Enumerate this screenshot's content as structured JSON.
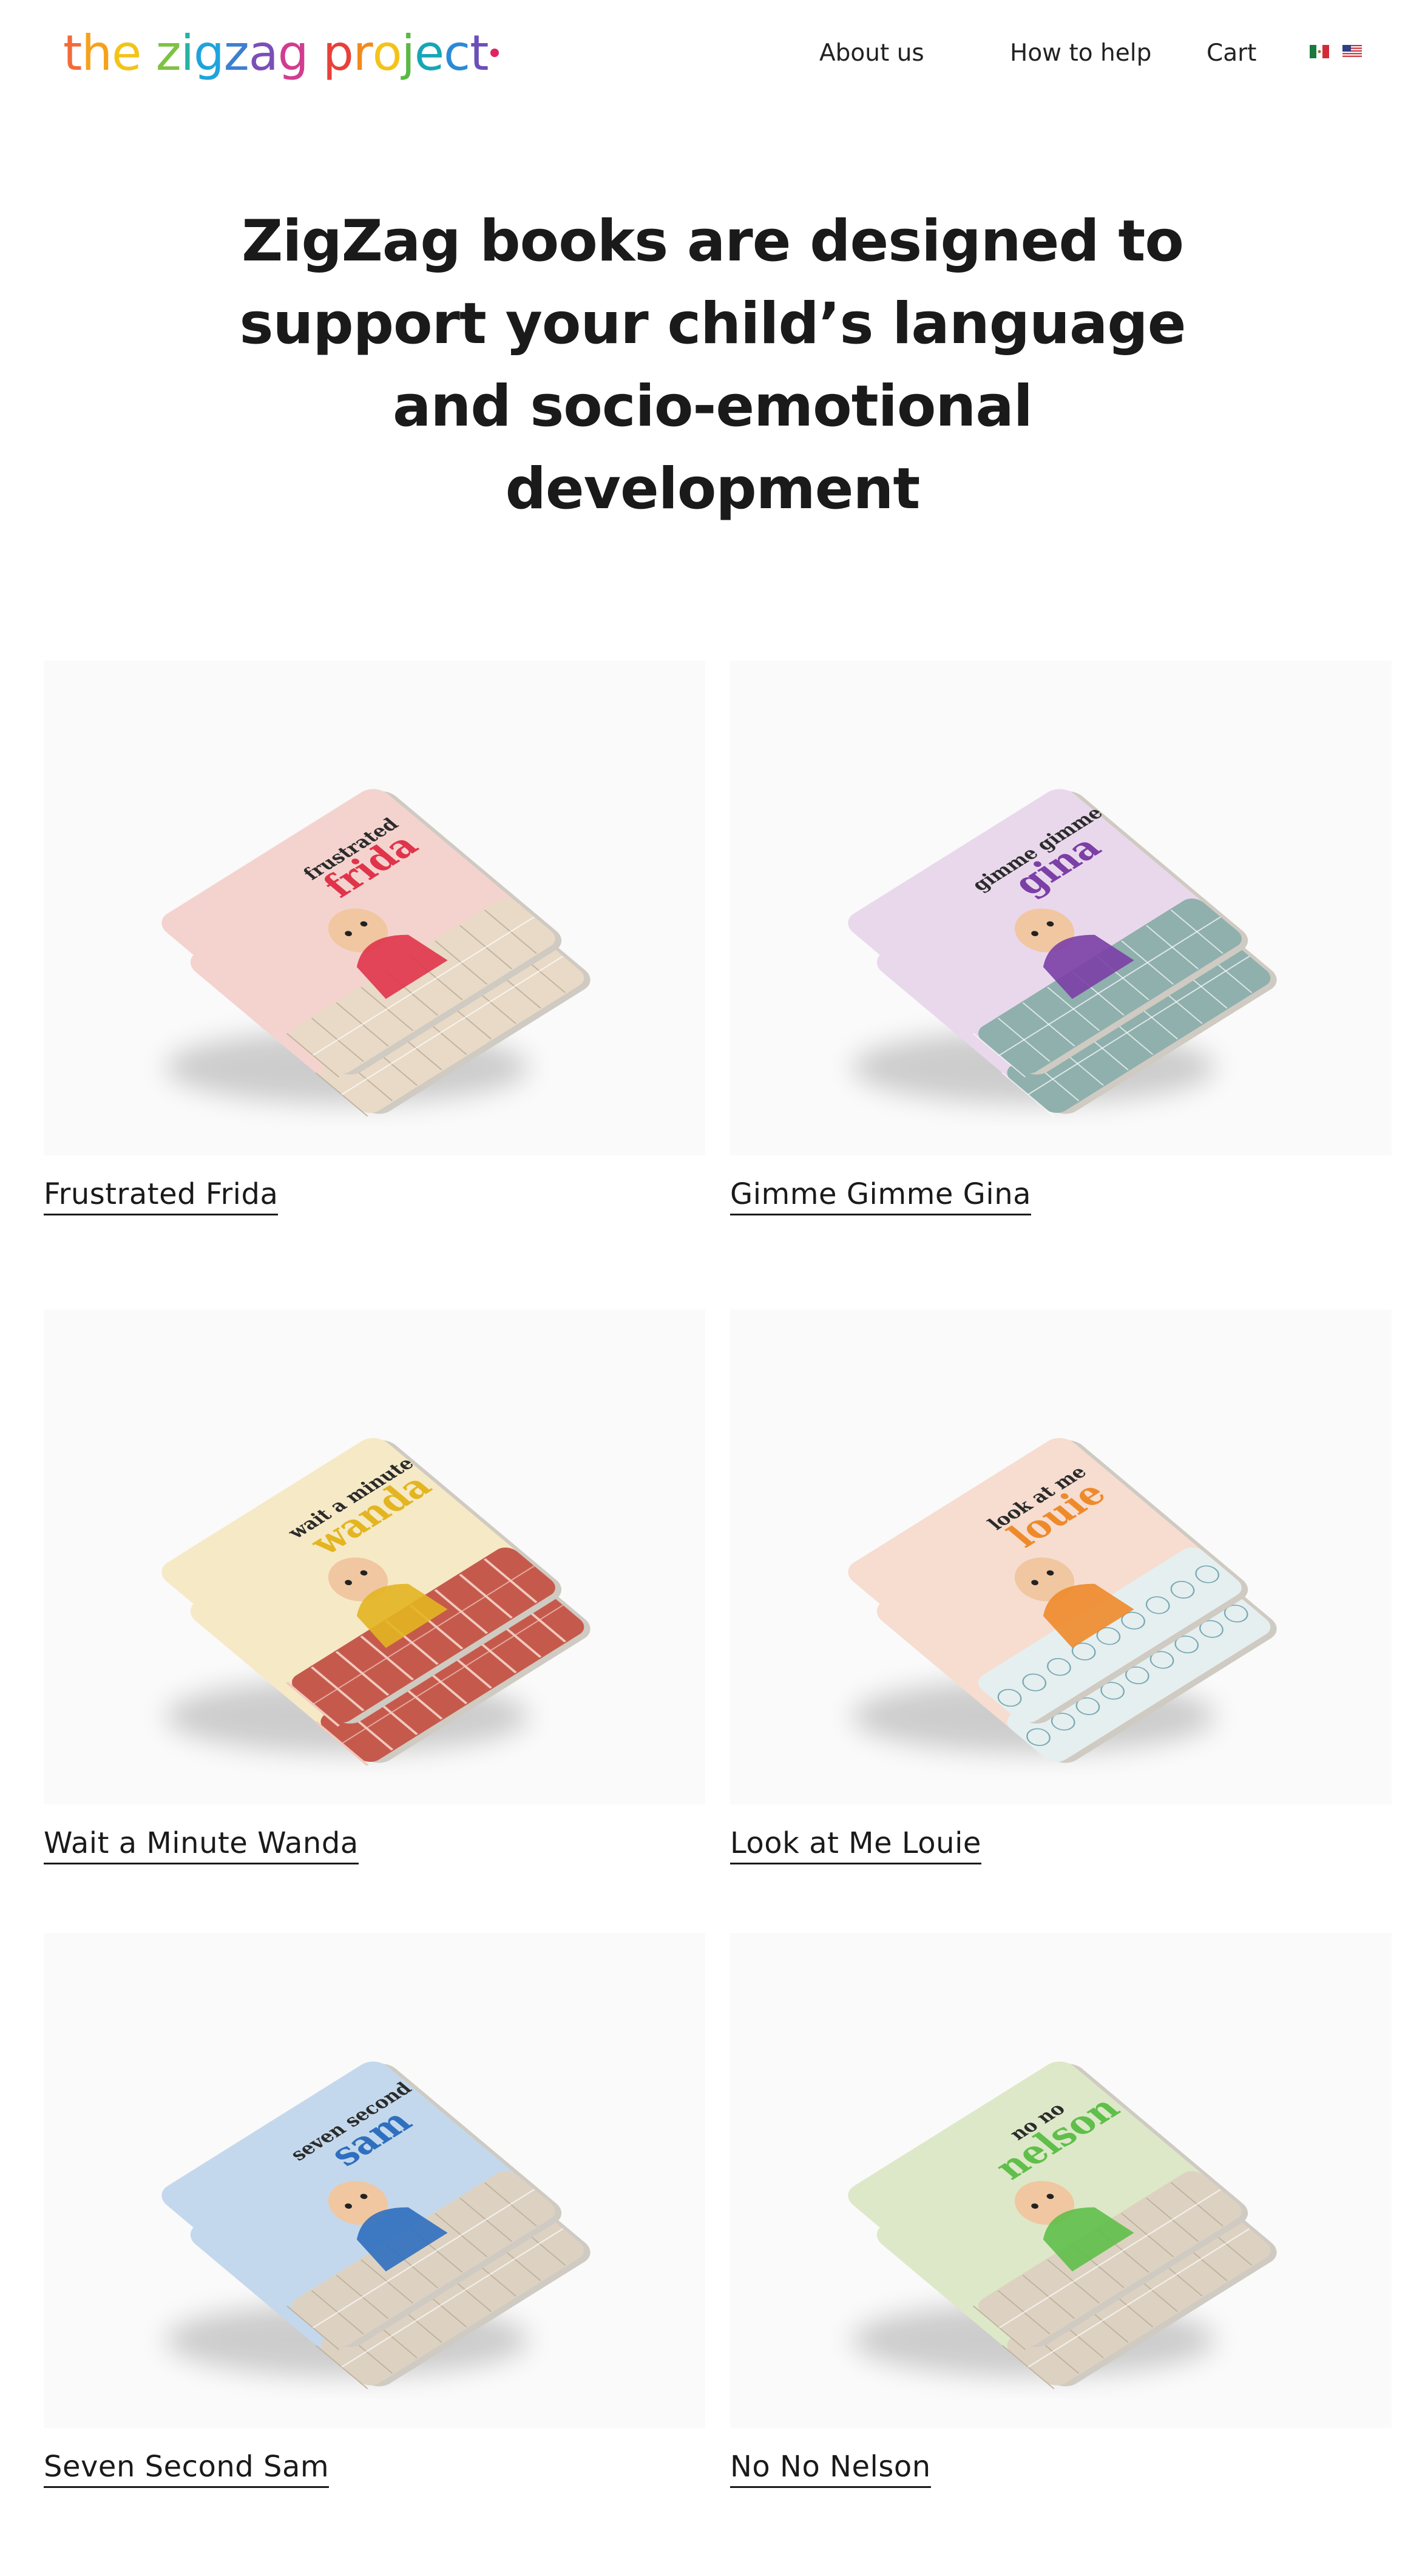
{
  "header": {
    "logo": {
      "text": "the zigzag project",
      "letters": [
        {
          "ch": "t",
          "color": "#f26b3a"
        },
        {
          "ch": "h",
          "color": "#f6a11c"
        },
        {
          "ch": "e",
          "color": "#f3c319"
        },
        {
          "ch": " ",
          "color": "#000000"
        },
        {
          "ch": "z",
          "color": "#7dc242"
        },
        {
          "ch": "i",
          "color": "#25b3a4"
        },
        {
          "ch": "g",
          "color": "#1fa3dd"
        },
        {
          "ch": "z",
          "color": "#3d7fd0"
        },
        {
          "ch": "a",
          "color": "#7a4fb8"
        },
        {
          "ch": "g",
          "color": "#d23c8f"
        },
        {
          "ch": " ",
          "color": "#000000"
        },
        {
          "ch": "p",
          "color": "#e8403a"
        },
        {
          "ch": "r",
          "color": "#f28a1c"
        },
        {
          "ch": "o",
          "color": "#f3c319"
        },
        {
          "ch": "j",
          "color": "#5bb746"
        },
        {
          "ch": "e",
          "color": "#16a6b6"
        },
        {
          "ch": "c",
          "color": "#2b8ad6"
        },
        {
          "ch": "t",
          "color": "#6b4fb8"
        }
      ]
    },
    "nav": {
      "about": "About us",
      "help": "How to help",
      "cart": "Cart"
    },
    "flags": [
      "mexico-flag-icon",
      "us-flag-icon"
    ]
  },
  "hero": {
    "line1": "ZigZag books are designed to",
    "line2": "support your child’s language",
    "line3": "and socio-emotional",
    "line4": "development"
  },
  "products": [
    {
      "title": "Frustrated Frida",
      "cover_line1": "frustrated",
      "cover_line2": "frida",
      "cover_color": "#f4d3cf",
      "accent": "#e0344a",
      "side_color": "#e8dac6",
      "pattern": "wood"
    },
    {
      "title": "Gimme Gimme Gina",
      "cover_line1": "gimme gimme",
      "cover_line2": "gina",
      "cover_color": "#e9d8ec",
      "accent": "#7b3fa6",
      "side_color": "#8fb0ad",
      "pattern": "tiles"
    },
    {
      "title": "Wait a Minute Wanda",
      "cover_line1": "wait a minute",
      "cover_line2": "wanda",
      "cover_color": "#f6e9c6",
      "accent": "#e3b521",
      "side_color": "#c55a4c",
      "pattern": "brick"
    },
    {
      "title": "Look at Me Louie",
      "cover_line1": "look at me",
      "cover_line2": "louie",
      "cover_color": "#f6ddd0",
      "accent": "#ee8a2a",
      "side_color": "#e5eff0",
      "pattern": "hex"
    },
    {
      "title": "Seven Second Sam",
      "cover_line1": "seven second",
      "cover_line2": "sam",
      "cover_color": "#c3d8ec",
      "accent": "#2f6fbf",
      "side_color": "#ddd2c2",
      "pattern": "wood"
    },
    {
      "title": "No No Nelson",
      "cover_line1": "no no",
      "cover_line2": "nelson",
      "cover_color": "#dde8c8",
      "accent": "#5fbf4a",
      "side_color": "#ddd2c2",
      "pattern": "wood"
    }
  ]
}
